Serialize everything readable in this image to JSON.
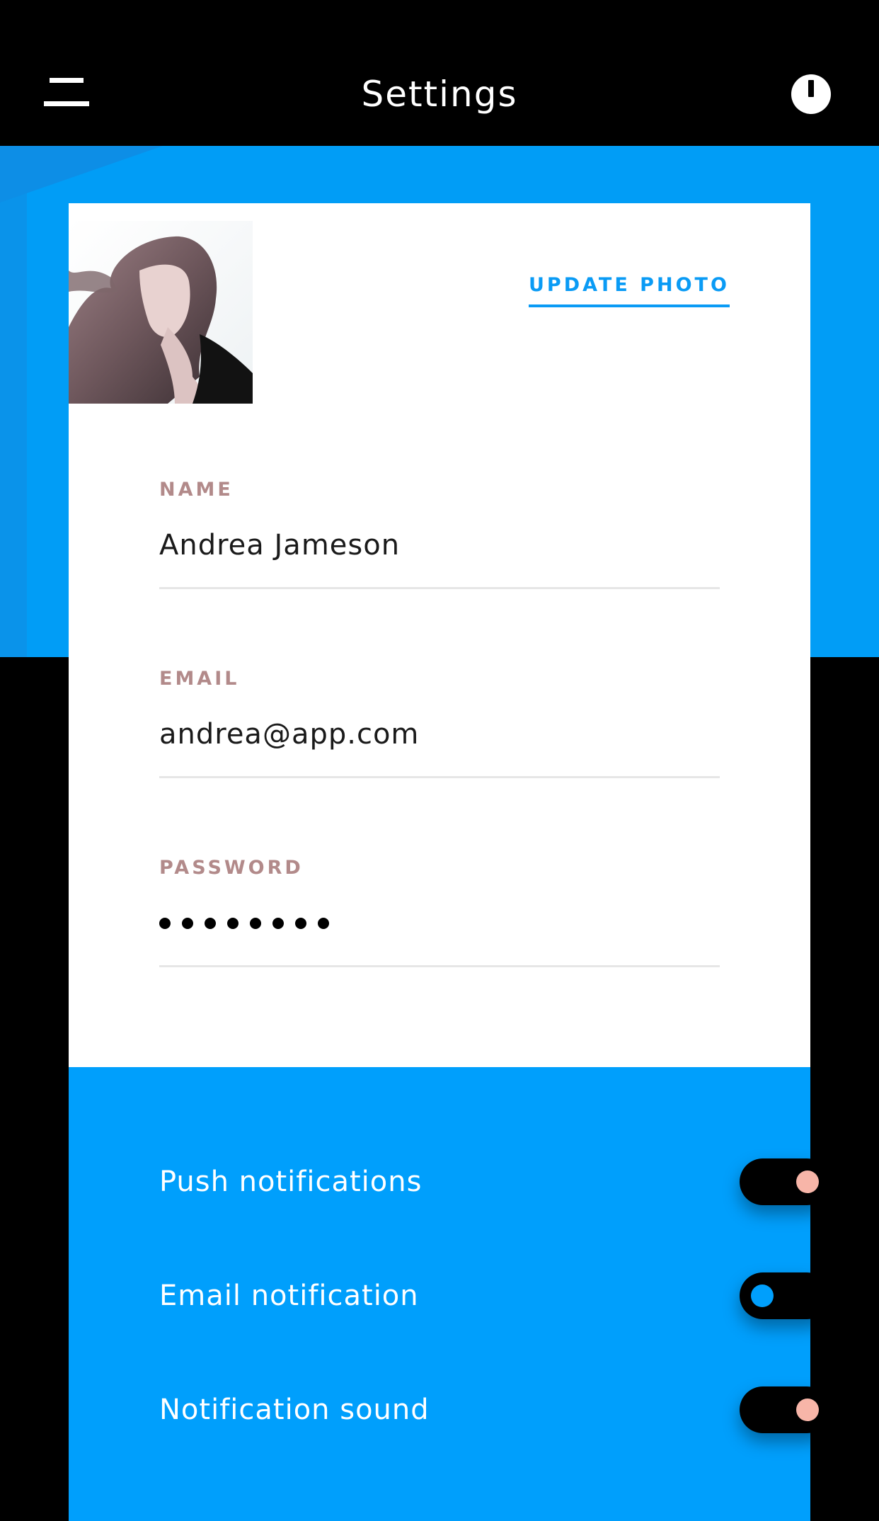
{
  "header": {
    "title": "Settings",
    "menu_icon": "hamburger-menu-icon",
    "power_icon": "power-icon"
  },
  "profile": {
    "update_photo_label": "UPDATE PHOTO"
  },
  "fields": {
    "name": {
      "label": "NAME",
      "value": "Andrea Jameson"
    },
    "email": {
      "label": "EMAIL",
      "value": "andrea@app.com"
    },
    "password": {
      "label": "PASSWORD",
      "masked_length": 8
    }
  },
  "notifications": [
    {
      "label": "Push notifications",
      "enabled": true
    },
    {
      "label": "Email notification",
      "enabled": false
    },
    {
      "label": "Notification sound",
      "enabled": true
    }
  ],
  "colors": {
    "primary_blue": "#009ffc",
    "label_rose": "#b28a8a",
    "toggle_knob_on": "#f7b5a8",
    "background": "#000000"
  }
}
